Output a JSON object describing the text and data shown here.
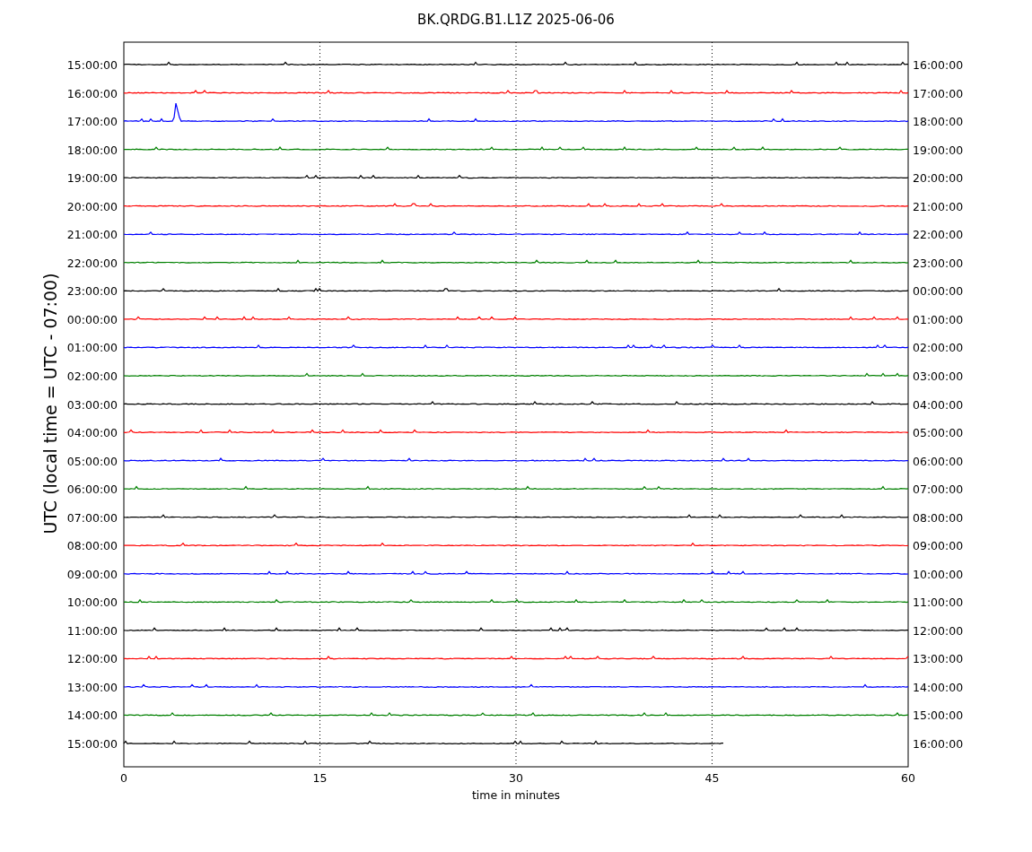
{
  "title": "BK.QRDG.B1.L1Z 2025-06-06",
  "y_axis_label": "UTC (local time = UTC - 07:00)",
  "x_axis_label": "time in minutes",
  "x_ticks": [
    "0",
    "15",
    "30",
    "45",
    "60"
  ],
  "rows": [
    {
      "left_label": "15:00:00",
      "right_label": "16:00:00",
      "color": "#000000",
      "level": 1
    },
    {
      "left_label": "16:00:00",
      "right_label": "17:00:00",
      "color": "#ff0000",
      "level": 1
    },
    {
      "left_label": "17:00:00",
      "right_label": "18:00:00",
      "color": "#0000ff",
      "level": 1
    },
    {
      "left_label": "18:00:00",
      "right_label": "19:00:00",
      "color": "#008000",
      "level": 1
    },
    {
      "left_label": "19:00:00",
      "right_label": "20:00:00",
      "color": "#000000",
      "level": 1
    },
    {
      "left_label": "20:00:00",
      "right_label": "21:00:00",
      "color": "#ff0000",
      "level": 1
    },
    {
      "left_label": "21:00:00",
      "right_label": "22:00:00",
      "color": "#0000ff",
      "level": 1
    },
    {
      "left_label": "22:00:00",
      "right_label": "23:00:00",
      "color": "#008000",
      "level": 1
    },
    {
      "left_label": "23:00:00",
      "right_label": "00:00:00",
      "color": "#000000",
      "level": 1
    },
    {
      "left_label": "00:00:00",
      "right_label": "01:00:00",
      "color": "#ff0000",
      "level": 1
    },
    {
      "left_label": "01:00:00",
      "right_label": "02:00:00",
      "color": "#0000ff",
      "level": 1
    },
    {
      "left_label": "02:00:00",
      "right_label": "03:00:00",
      "color": "#008000",
      "level": 1
    },
    {
      "left_label": "03:00:00",
      "right_label": "04:00:00",
      "color": "#000000",
      "level": 1
    },
    {
      "left_label": "04:00:00",
      "right_label": "05:00:00",
      "color": "#ff0000",
      "level": 1
    },
    {
      "left_label": "05:00:00",
      "right_label": "06:00:00",
      "color": "#0000ff",
      "level": 1
    },
    {
      "left_label": "06:00:00",
      "right_label": "07:00:00",
      "color": "#008000",
      "level": 1
    },
    {
      "left_label": "07:00:00",
      "right_label": "08:00:00",
      "color": "#000000",
      "level": 1
    },
    {
      "left_label": "08:00:00",
      "right_label": "09:00:00",
      "color": "#ff0000",
      "level": 1
    },
    {
      "left_label": "09:00:00",
      "right_label": "10:00:00",
      "color": "#0000ff",
      "level": 1
    },
    {
      "left_label": "10:00:00",
      "right_label": "11:00:00",
      "color": "#008000",
      "level": 1
    },
    {
      "left_label": "11:00:00",
      "right_label": "12:00:00",
      "color": "#000000",
      "level": 1
    },
    {
      "left_label": "12:00:00",
      "right_label": "13:00:00",
      "color": "#ff0000",
      "level": 1
    },
    {
      "left_label": "13:00:00",
      "right_label": "14:00:00",
      "color": "#0000ff",
      "level": 1
    },
    {
      "left_label": "14:00:00",
      "right_label": "15:00:00",
      "color": "#008000",
      "level": 1
    },
    {
      "left_label": "15:00:00",
      "right_label": "16:00:00",
      "color": "#000000",
      "level": 0.766
    }
  ]
}
